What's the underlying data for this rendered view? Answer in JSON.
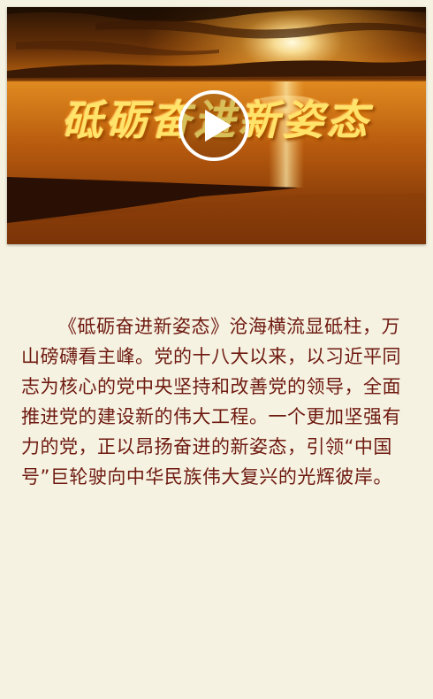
{
  "video": {
    "title_overlay": "砥砺奋进新姿态",
    "play_icon": "play-icon"
  },
  "article": {
    "paragraph": "《砥砺奋进新姿态》沧海横流显砥柱，万山磅礴看主峰。党的十八大以来，以习近平同志为核心的党中央坚持和改善党的领导，全面推进党的建设新的伟大工程。一个更加坚强有力的党，正以昂扬奋进的新姿态，引领“中国号”巨轮驶向中华民族伟大复兴的光辉彼岸。"
  },
  "colors": {
    "page_background": "#f6f2e2",
    "text": "#6e1a10",
    "title_gold": "#ffe36a"
  }
}
